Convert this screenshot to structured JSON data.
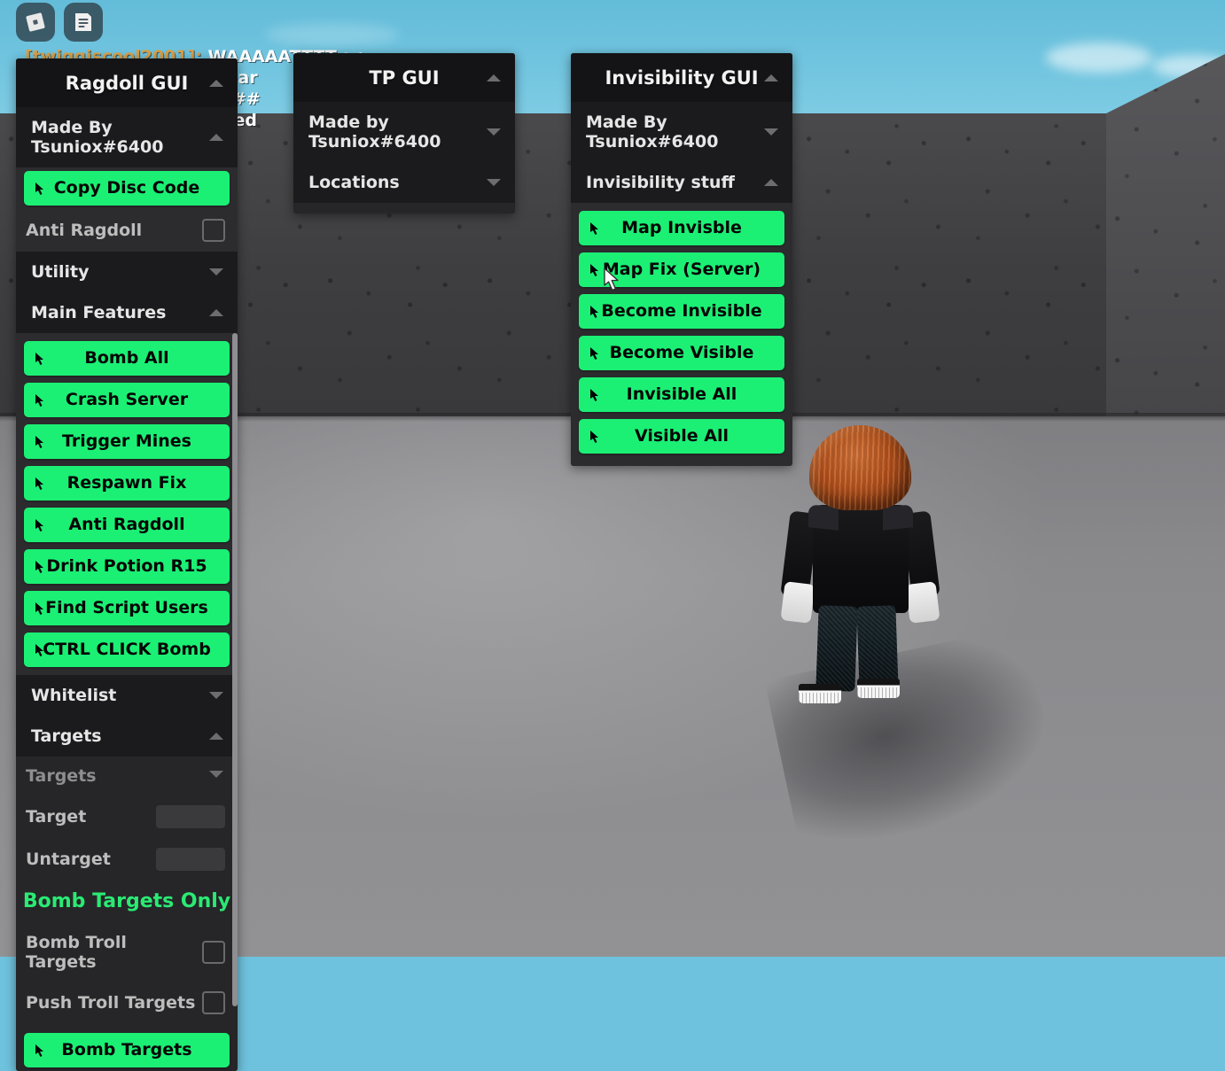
{
  "topbar": {
    "icons": [
      {
        "name": "roblox-logo-icon",
        "label": "Roblox"
      },
      {
        "name": "chat-icon",
        "label": "Chat"
      }
    ]
  },
  "chat": {
    "lines": [
      {
        "name": "[twiggiscool2001]:",
        "text": "WAAAAATTTT ;<",
        "color": "#d8a04a"
      },
      {
        "name": "[",
        "text": "gear",
        "color": "#d8a04a"
      },
      {
        "name": "[",
        "text": "###",
        "color": "#2ecc5a"
      },
      {
        "name": "[",
        "text": "essed",
        "color": "#cfcfcf"
      }
    ]
  },
  "panels": [
    {
      "id": "ragdoll",
      "title": "Ragdoll GUI",
      "title_caret": "up",
      "credit": {
        "label": "Made By Tsuniox#6400",
        "caret": "up"
      },
      "blocks": [
        {
          "type": "button",
          "label": "Copy Disc Code"
        },
        {
          "type": "checkbox-row",
          "label": "Anti Ragdoll",
          "checked": false
        },
        {
          "type": "section",
          "label": "Utility",
          "caret": "down"
        },
        {
          "type": "section",
          "label": "Main Features",
          "caret": "up"
        },
        {
          "type": "button",
          "label": "Bomb All"
        },
        {
          "type": "button",
          "label": "Crash Server"
        },
        {
          "type": "button",
          "label": "Trigger Mines"
        },
        {
          "type": "button",
          "label": "Respawn Fix"
        },
        {
          "type": "button",
          "label": "Anti Ragdoll"
        },
        {
          "type": "button",
          "label": "Drink Potion R15"
        },
        {
          "type": "button",
          "label": "Find Script Users"
        },
        {
          "type": "button",
          "label": "CTRL CLICK Bomb"
        },
        {
          "type": "section",
          "label": "Whitelist",
          "caret": "down"
        },
        {
          "type": "section",
          "label": "Targets",
          "caret": "up"
        },
        {
          "type": "subsection",
          "label": "Targets",
          "caret": "down"
        },
        {
          "type": "textbox-row",
          "label": "Target",
          "value": ""
        },
        {
          "type": "textbox-row",
          "label": "Untarget",
          "value": ""
        },
        {
          "type": "green-label",
          "label": "Bomb Targets Only"
        },
        {
          "type": "checkbox-row",
          "label": "Bomb Troll Targets",
          "checked": false
        },
        {
          "type": "checkbox-row",
          "label": "Push Troll Targets",
          "checked": false
        },
        {
          "type": "button",
          "label": "Bomb Targets"
        }
      ]
    },
    {
      "id": "tp",
      "title": "TP GUI",
      "title_caret": "up",
      "credit": {
        "label": "Made by Tsuniox#6400",
        "caret": "down"
      },
      "blocks": [
        {
          "type": "section",
          "label": "Locations",
          "caret": "down"
        }
      ]
    },
    {
      "id": "invis",
      "title": "Invisibility GUI",
      "title_caret": "up",
      "credit": {
        "label": "Made By Tsuniox#6400",
        "caret": "down"
      },
      "blocks": [
        {
          "type": "section",
          "label": "Invisibility stuff",
          "caret": "up"
        },
        {
          "type": "button",
          "label": "Map Invisble"
        },
        {
          "type": "button",
          "label": "Map Fix (Server)"
        },
        {
          "type": "button",
          "label": "Become Invisible"
        },
        {
          "type": "button",
          "label": "Become Visible"
        },
        {
          "type": "button",
          "label": "Invisible All"
        },
        {
          "type": "button",
          "label": "Visible All"
        }
      ]
    }
  ],
  "colors": {
    "accent_green": "#1bf075",
    "panel_bg": "#262628",
    "panel_header": "#141416",
    "sky": "#6ec2dd",
    "wall": "#3e3e40",
    "floor": "#9a9a9d"
  }
}
